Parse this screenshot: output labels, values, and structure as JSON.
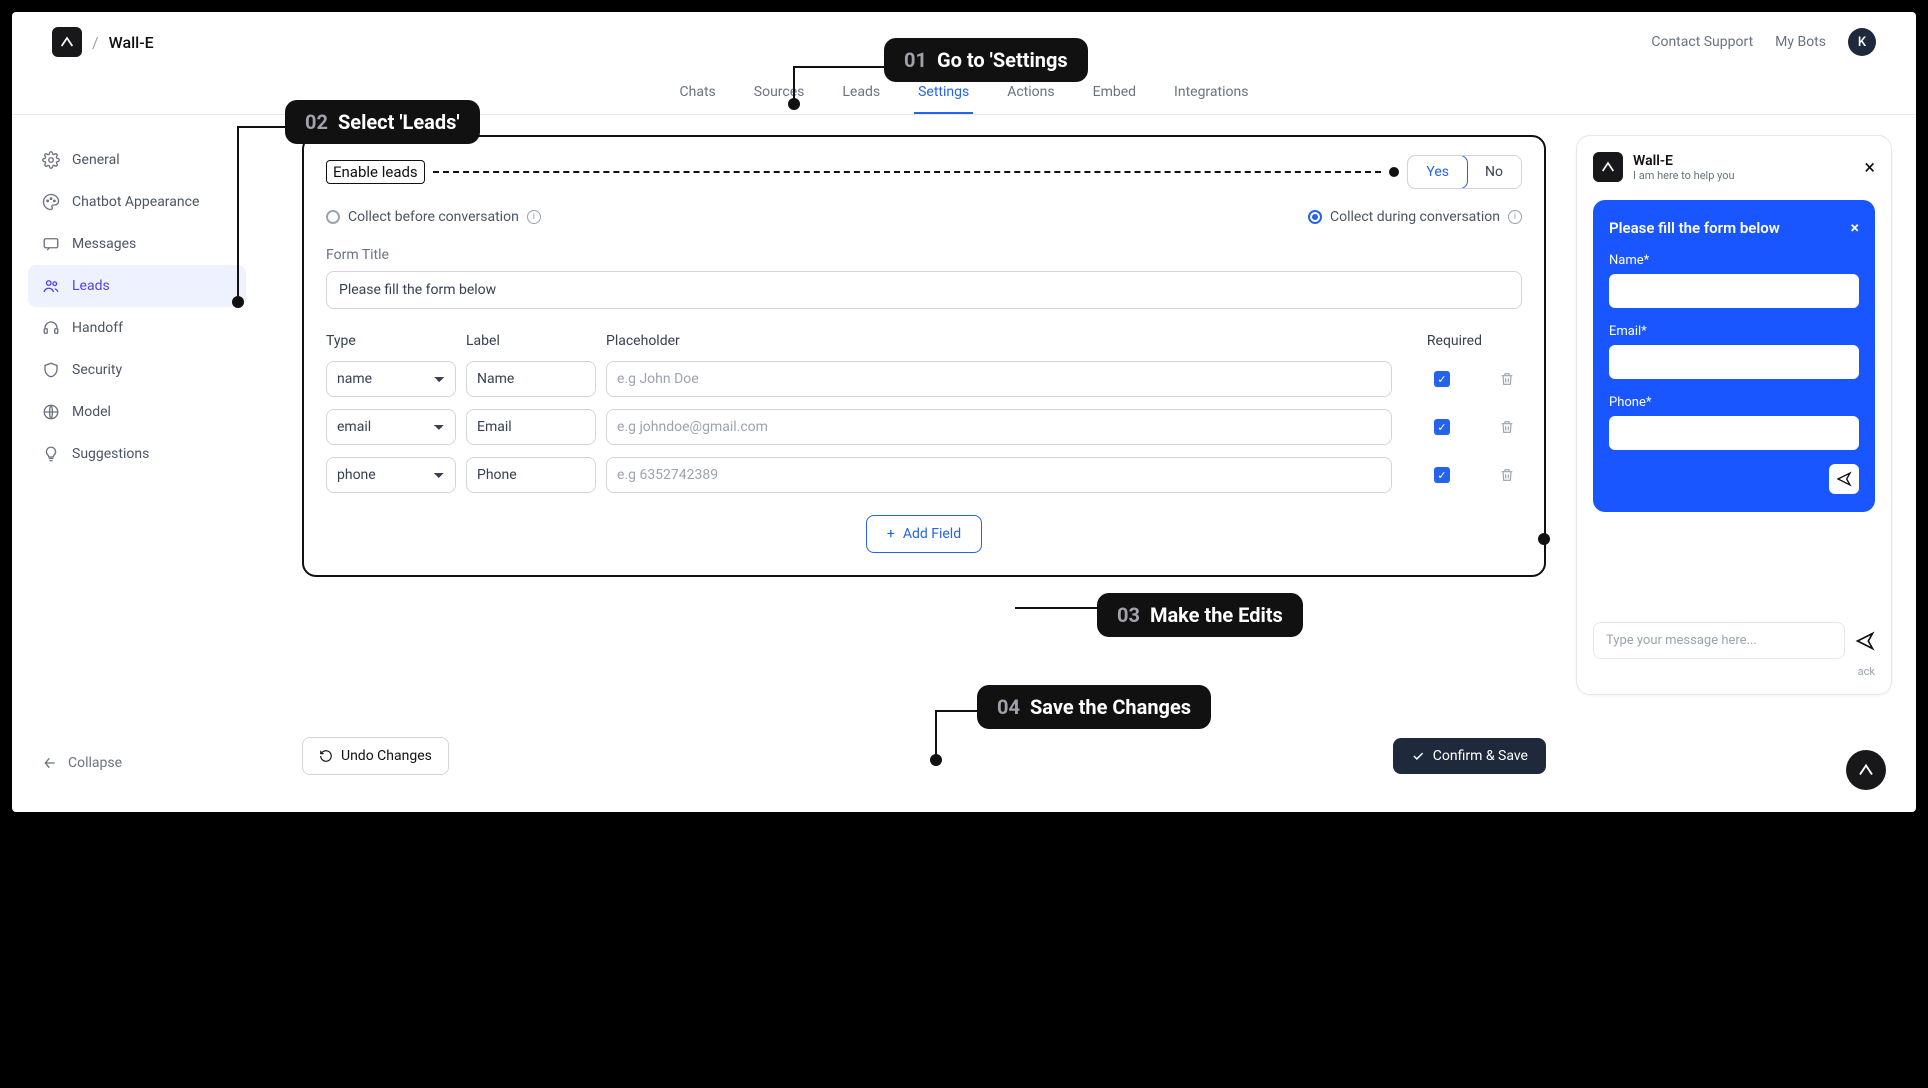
{
  "header": {
    "bot_name": "Wall-E",
    "contact_support": "Contact Support",
    "my_bots": "My Bots",
    "avatar_initial": "K"
  },
  "tabs": [
    "Chats",
    "Sources",
    "Leads",
    "Settings",
    "Actions",
    "Embed",
    "Integrations"
  ],
  "active_tab": "Settings",
  "sidebar": {
    "items": [
      {
        "label": "General",
        "icon": "gear"
      },
      {
        "label": "Chatbot Appearance",
        "icon": "palette"
      },
      {
        "label": "Messages",
        "icon": "chat"
      },
      {
        "label": "Leads",
        "icon": "users",
        "active": true
      },
      {
        "label": "Handoff",
        "icon": "headset"
      },
      {
        "label": "Security",
        "icon": "shield"
      },
      {
        "label": "Model",
        "icon": "globe"
      },
      {
        "label": "Suggestions",
        "icon": "bulb"
      }
    ],
    "collapse": "Collapse"
  },
  "settings": {
    "enable_label": "Enable leads",
    "yes": "Yes",
    "no": "No",
    "radio_before": "Collect before conversation",
    "radio_during": "Collect during conversation",
    "form_title_label": "Form Title",
    "form_title_value": "Please fill the form below",
    "headers": {
      "type": "Type",
      "label": "Label",
      "placeholder": "Placeholder",
      "required": "Required"
    },
    "fields": [
      {
        "type": "name",
        "label": "Name",
        "placeholder": "e.g John Doe",
        "required": true
      },
      {
        "type": "email",
        "label": "Email",
        "placeholder": "e.g johndoe@gmail.com",
        "required": true
      },
      {
        "type": "phone",
        "label": "Phone",
        "placeholder": "e.g 6352742389",
        "required": true
      }
    ],
    "add_field": "Add Field"
  },
  "actions": {
    "undo": "Undo Changes",
    "confirm": "Confirm & Save"
  },
  "preview": {
    "title": "Wall-E",
    "subtitle": "I am here to help you",
    "form_header": "Please fill the form below",
    "fields": [
      "Name*",
      "Email*",
      "Phone*"
    ],
    "msg_placeholder": "Type your message here...",
    "footer": "ack"
  },
  "callouts": {
    "c1": {
      "num": "01",
      "text": "Go to 'Settings"
    },
    "c2": {
      "num": "02",
      "text": "Select  'Leads'"
    },
    "c3": {
      "num": "03",
      "text": "Make the Edits"
    },
    "c4": {
      "num": "04",
      "text": "Save the Changes"
    }
  }
}
